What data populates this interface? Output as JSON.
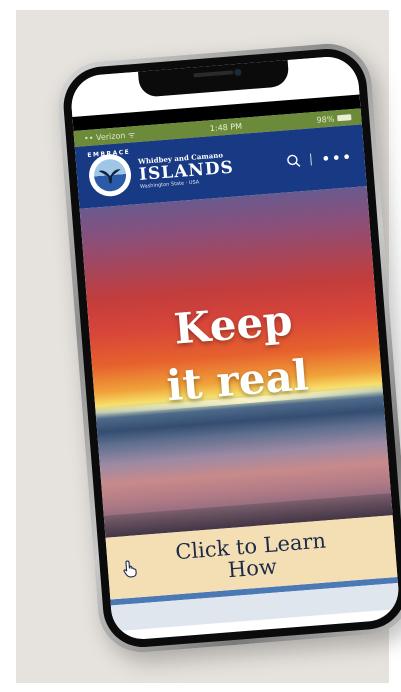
{
  "status_bar": {
    "carrier": "Verizon",
    "time": "1:48 PM",
    "battery": "98%"
  },
  "header": {
    "badge_text": "EMBRACE",
    "brand_top": "Whidbey and Camano",
    "brand_main": "ISLANDS",
    "brand_sub": "Washington State · USA",
    "icons": [
      "search-icon",
      "more-icon"
    ]
  },
  "hero": {
    "title_line1": "Keep",
    "title_line2": "it real"
  },
  "cta": {
    "label": "Click to Learn How",
    "icon": "hand-pointer-icon"
  },
  "colors": {
    "header_bg": "#183a84",
    "status_bg": "#6c8b3a",
    "cta_bg": "#f4dfb5",
    "cta_text": "#1d2a48",
    "page_bg": "#e6e2dd"
  }
}
